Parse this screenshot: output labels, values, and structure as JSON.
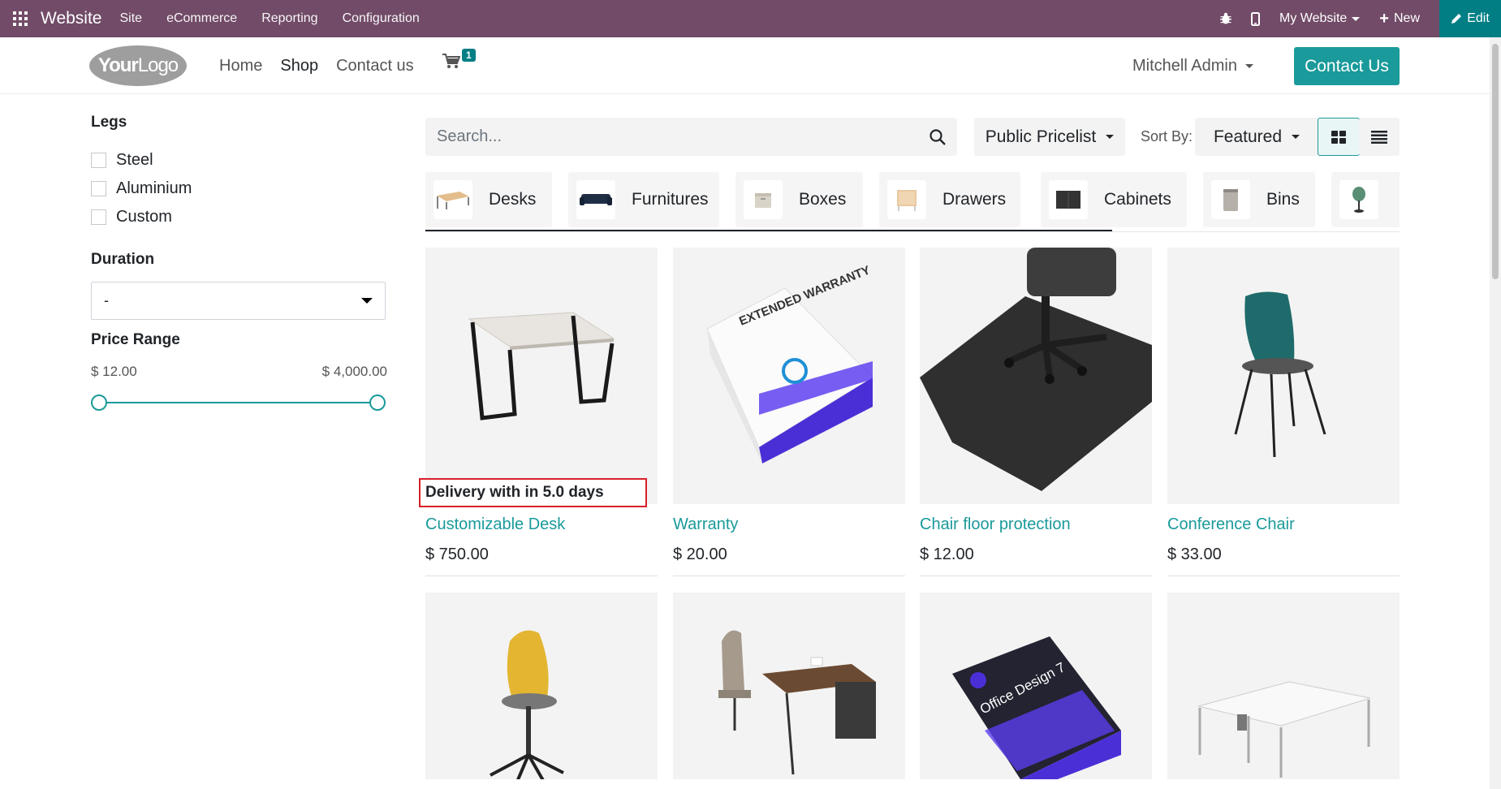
{
  "topbar": {
    "brand": "Website",
    "menu": [
      "Site",
      "eCommerce",
      "Reporting",
      "Configuration"
    ],
    "site_selector": "My Website",
    "new_label": "New",
    "edit_label": "Edit"
  },
  "header": {
    "logo_text_bold": "Your",
    "logo_text": "Logo",
    "nav": [
      "Home",
      "Shop",
      "Contact us"
    ],
    "cart_count": "1",
    "user": "Mitchell Admin",
    "contact_button": "Contact Us"
  },
  "sidebar": {
    "legs_title": "Legs",
    "legs": [
      "Steel",
      "Aluminium",
      "Custom"
    ],
    "duration_title": "Duration",
    "duration_value": "-",
    "price_title": "Price Range",
    "price_min": "$ 12.00",
    "price_max": "$ 4,000.00"
  },
  "toolbar": {
    "search_placeholder": "Search...",
    "pricelist": "Public Pricelist",
    "sort_label": "Sort By:",
    "sort_value": "Featured"
  },
  "categories": [
    "Desks",
    "Furnitures",
    "Boxes",
    "Drawers",
    "Cabinets",
    "Bins"
  ],
  "delivery_text": "Delivery with in 5.0 days",
  "products": [
    {
      "name": "Customizable Desk",
      "price": "$ 750.00"
    },
    {
      "name": "Warranty",
      "price": "$ 20.00"
    },
    {
      "name": "Chair floor protection",
      "price": "$ 12.00"
    },
    {
      "name": "Conference Chair",
      "price": "$ 33.00"
    }
  ],
  "warranty_box_text": "EXTENDED WARRANTY",
  "office_box_text": "Office Design 7",
  "colors": {
    "topbar": "#714B67",
    "accent": "#1a9a9a",
    "edit": "#017E84",
    "highlight": "#d8202a"
  }
}
